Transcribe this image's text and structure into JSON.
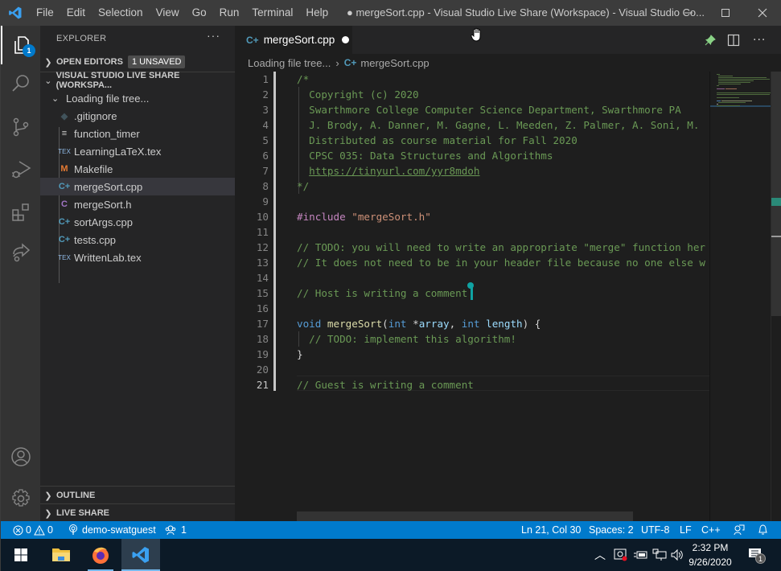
{
  "window": {
    "title": "● mergeSort.cpp - Visual Studio Live Share (Workspace) - Visual Studio Co...",
    "menu": [
      "File",
      "Edit",
      "Selection",
      "View",
      "Go",
      "Run",
      "Terminal",
      "Help"
    ],
    "controls": {
      "minimize": "minimize-icon",
      "maximize": "maximize-icon",
      "close": "close-icon"
    }
  },
  "activity_bar": {
    "items": [
      {
        "name": "explorer",
        "icon": "files-icon",
        "badge": "1",
        "active": true
      },
      {
        "name": "search",
        "icon": "search-icon"
      },
      {
        "name": "source-control",
        "icon": "source-control-icon"
      },
      {
        "name": "run-debug",
        "icon": "run-debug-icon"
      },
      {
        "name": "extensions",
        "icon": "extensions-icon"
      },
      {
        "name": "live-share",
        "icon": "live-share-icon"
      }
    ],
    "bottom": [
      {
        "name": "accounts",
        "icon": "account-icon"
      },
      {
        "name": "manage",
        "icon": "gear-icon"
      }
    ]
  },
  "sidebar": {
    "title": "EXPLORER",
    "more": "···",
    "open_editors": {
      "label": "OPEN EDITORS",
      "badge": "1 UNSAVED"
    },
    "workspace": {
      "label": "VISUAL STUDIO LIVE SHARE (WORKSPA..."
    },
    "folder": {
      "label": "Loading file tree..."
    },
    "files": [
      {
        "name": ".gitignore",
        "icon": "git-icon",
        "glyph": "◆",
        "color": "#41535b"
      },
      {
        "name": "function_timer",
        "icon": "text-file-icon",
        "glyph": "≡",
        "color": "#cccccc"
      },
      {
        "name": "LearningLaTeX.tex",
        "icon": "tex-icon",
        "glyph": "TEX",
        "color": "#8fb9e6"
      },
      {
        "name": "Makefile",
        "icon": "makefile-icon",
        "glyph": "M",
        "color": "#e37933"
      },
      {
        "name": "mergeSort.cpp",
        "icon": "cpp-icon",
        "glyph": "C+",
        "color": "#519aba",
        "selected": true
      },
      {
        "name": "mergeSort.h",
        "icon": "c-header-icon",
        "glyph": "C",
        "color": "#a074c4"
      },
      {
        "name": "sortArgs.cpp",
        "icon": "cpp-icon",
        "glyph": "C+",
        "color": "#519aba"
      },
      {
        "name": "tests.cpp",
        "icon": "cpp-icon",
        "glyph": "C+",
        "color": "#519aba"
      },
      {
        "name": "WrittenLab.tex",
        "icon": "tex-icon",
        "glyph": "TEX",
        "color": "#8fb9e6"
      }
    ],
    "outline": "OUTLINE",
    "live_share": "LIVE SHARE"
  },
  "editor": {
    "tab": {
      "label": "mergeSort.cpp",
      "dirty": true
    },
    "breadcrumb": [
      "Loading file tree...",
      "mergeSort.cpp"
    ],
    "current_line": 21,
    "lines": [
      [
        {
          "t": "/*",
          "c": "cm"
        }
      ],
      [
        {
          "t": "  Copyright (c) 2020",
          "c": "cm"
        }
      ],
      [
        {
          "t": "  Swarthmore College Computer Science Department, Swarthmore PA",
          "c": "cm"
        }
      ],
      [
        {
          "t": "  J. Brody, A. Danner, M. Gagne, L. Meeden, Z. Palmer, A. Soni, M.",
          "c": "cm"
        }
      ],
      [
        {
          "t": "  Distributed as course material for Fall 2020",
          "c": "cm"
        }
      ],
      [
        {
          "t": "  CPSC 035: Data Structures and Algorithms",
          "c": "cm"
        }
      ],
      [
        {
          "t": "  ",
          "c": "cm"
        },
        {
          "t": "https://tinyurl.com/yyr8mdoh",
          "c": "cm link"
        }
      ],
      [
        {
          "t": "*/",
          "c": "cm"
        }
      ],
      [],
      [
        {
          "t": "#include ",
          "c": "pp"
        },
        {
          "t": "\"mergeSort.h\"",
          "c": "str"
        }
      ],
      [],
      [
        {
          "t": "// TODO: you will need to write an appropriate \"merge\" function her",
          "c": "cm"
        }
      ],
      [
        {
          "t": "// It does not need to be in your header file because no one else w",
          "c": "cm"
        }
      ],
      [],
      [
        {
          "t": "// Host is writing a comment",
          "c": "cm"
        }
      ],
      [],
      [
        {
          "t": "void ",
          "c": "kw"
        },
        {
          "t": "mergeSort",
          "c": "fn"
        },
        {
          "t": "(",
          "c": "pl"
        },
        {
          "t": "int ",
          "c": "kw"
        },
        {
          "t": "*",
          "c": "pl"
        },
        {
          "t": "array",
          "c": "var"
        },
        {
          "t": ", ",
          "c": "pl"
        },
        {
          "t": "int ",
          "c": "kw"
        },
        {
          "t": "length",
          "c": "var"
        },
        {
          "t": ") {",
          "c": "pl"
        }
      ],
      [
        {
          "t": "  // TODO: implement this algorithm!",
          "c": "cm"
        }
      ],
      [
        {
          "t": "}",
          "c": "pl"
        }
      ],
      [],
      [
        {
          "t": "// Guest is writing a comment",
          "c": "cm"
        }
      ]
    ],
    "actions": [
      "pin-icon",
      "split-editor-icon",
      "more-actions-icon"
    ],
    "colors": {
      "host_cursor": "#0fa3a3",
      "accent": "#007acc",
      "comment": "#6a9955"
    }
  },
  "status_bar": {
    "errors": "0",
    "warnings": "0",
    "live_share_user": "demo-swatguest",
    "participants": "1",
    "position": "Ln 21, Col 30",
    "indent": "Spaces: 2",
    "encoding": "UTF-8",
    "eol": "LF",
    "language": "C++"
  },
  "taskbar": {
    "apps": [
      {
        "name": "start",
        "icon": "windows-icon"
      },
      {
        "name": "file-explorer",
        "icon": "folder-icon"
      },
      {
        "name": "firefox",
        "icon": "firefox-icon"
      },
      {
        "name": "vscode",
        "icon": "vscode-icon",
        "active": true
      }
    ],
    "time": "2:32 PM",
    "date": "9/26/2020",
    "notifications": "1"
  }
}
